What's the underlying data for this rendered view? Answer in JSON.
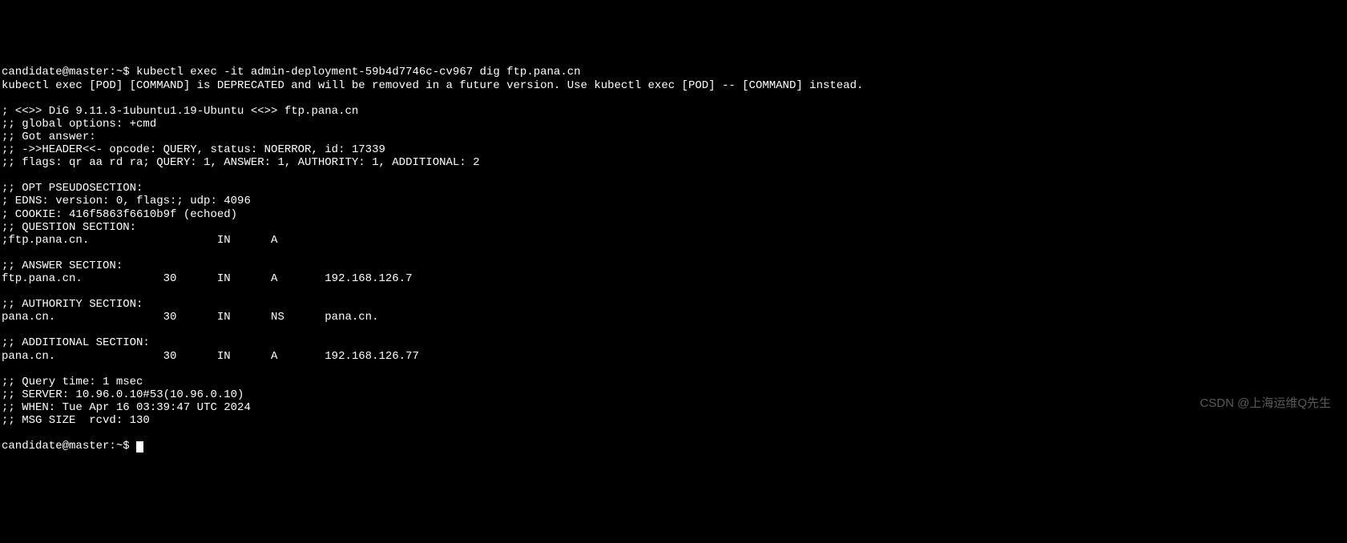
{
  "prompt1": {
    "user_host": "candidate@master",
    "path": "~",
    "symbol": "$",
    "command": "kubectl exec -it admin-deployment-59b4d7746c-cv967 dig ftp.pana.cn"
  },
  "deprecation_line": "kubectl exec [POD] [COMMAND] is DEPRECATED and will be removed in a future version. Use kubectl exec [POD] -- [COMMAND] instead.",
  "dig_header": "; <<>> DiG 9.11.3-1ubuntu1.19-Ubuntu <<>> ftp.pana.cn",
  "global_options": ";; global options: +cmd",
  "got_answer": ";; Got answer:",
  "header_line": ";; ->>HEADER<<- opcode: QUERY, status: NOERROR, id: 17339",
  "flags_line": ";; flags: qr aa rd ra; QUERY: 1, ANSWER: 1, AUTHORITY: 1, ADDITIONAL: 2",
  "opt_pseudo_header": ";; OPT PSEUDOSECTION:",
  "edns_line": "; EDNS: version: 0, flags:; udp: 4096",
  "cookie_line": "; COOKIE: 416f5863f6610b9f (echoed)",
  "question_header": ";; QUESTION SECTION:",
  "question_row": ";ftp.pana.cn.                   IN      A",
  "answer_header": ";; ANSWER SECTION:",
  "answer_row": "ftp.pana.cn.            30      IN      A       192.168.126.7",
  "authority_header": ";; AUTHORITY SECTION:",
  "authority_row": "pana.cn.                30      IN      NS      pana.cn.",
  "additional_header": ";; ADDITIONAL SECTION:",
  "additional_row": "pana.cn.                30      IN      A       192.168.126.77",
  "query_time": ";; Query time: 1 msec",
  "server_line": ";; SERVER: 10.96.0.10#53(10.96.0.10)",
  "when_line": ";; WHEN: Tue Apr 16 03:39:47 UTC 2024",
  "msg_size": ";; MSG SIZE  rcvd: 130",
  "prompt2": {
    "user_host": "candidate@master",
    "path": "~",
    "symbol": "$"
  },
  "watermark": "CSDN @上海运维Q先生"
}
